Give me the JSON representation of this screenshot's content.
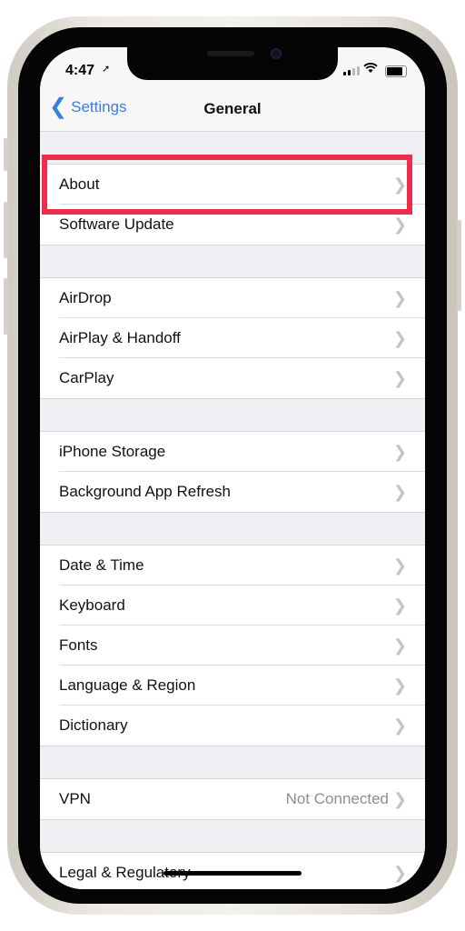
{
  "status_bar": {
    "time": "4:47",
    "location_icon": "location-arrow-icon",
    "signal_icon": "cellular-signal-icon",
    "wifi_icon": "wifi-icon",
    "battery_icon": "battery-icon"
  },
  "nav": {
    "back_label": "Settings",
    "title": "General"
  },
  "sections": [
    {
      "items": [
        {
          "label": "About"
        },
        {
          "label": "Software Update"
        }
      ]
    },
    {
      "items": [
        {
          "label": "AirDrop"
        },
        {
          "label": "AirPlay & Handoff"
        },
        {
          "label": "CarPlay"
        }
      ]
    },
    {
      "items": [
        {
          "label": "iPhone Storage"
        },
        {
          "label": "Background App Refresh"
        }
      ]
    },
    {
      "items": [
        {
          "label": "Date & Time"
        },
        {
          "label": "Keyboard"
        },
        {
          "label": "Fonts"
        },
        {
          "label": "Language & Region"
        },
        {
          "label": "Dictionary"
        }
      ]
    },
    {
      "items": [
        {
          "label": "VPN",
          "value": "Not Connected"
        }
      ]
    },
    {
      "items": [
        {
          "label": "Legal & Regulatory"
        }
      ]
    }
  ],
  "highlight": {
    "target": "About",
    "color": "#f02b4c"
  },
  "colors": {
    "accent": "#3a7fd6",
    "background": "#efeff4"
  }
}
